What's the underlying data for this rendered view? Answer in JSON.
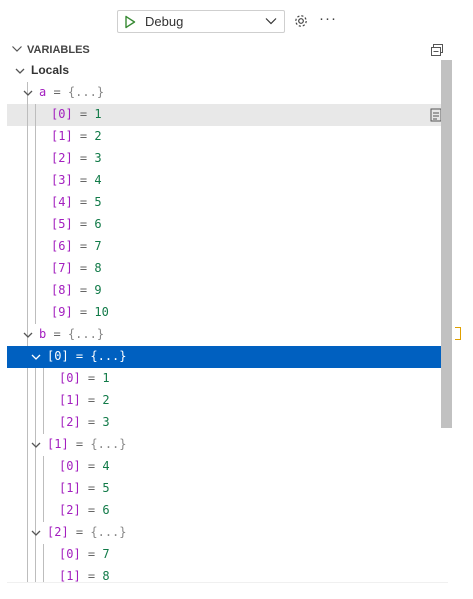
{
  "toolbar": {
    "config_name": "Debug"
  },
  "section": {
    "title": "VARIABLES"
  },
  "rows": [
    {
      "kind": "scope",
      "label": "Locals",
      "depth": 0,
      "open": true
    },
    {
      "kind": "var",
      "key": "a",
      "value": "{...}",
      "depth": 1,
      "expandable": true,
      "open": true
    },
    {
      "kind": "var",
      "key": "[0]",
      "value": "1",
      "depth": 2,
      "state": "hover"
    },
    {
      "kind": "var",
      "key": "[1]",
      "value": "2",
      "depth": 2
    },
    {
      "kind": "var",
      "key": "[2]",
      "value": "3",
      "depth": 2
    },
    {
      "kind": "var",
      "key": "[3]",
      "value": "4",
      "depth": 2
    },
    {
      "kind": "var",
      "key": "[4]",
      "value": "5",
      "depth": 2
    },
    {
      "kind": "var",
      "key": "[5]",
      "value": "6",
      "depth": 2
    },
    {
      "kind": "var",
      "key": "[6]",
      "value": "7",
      "depth": 2
    },
    {
      "kind": "var",
      "key": "[7]",
      "value": "8",
      "depth": 2
    },
    {
      "kind": "var",
      "key": "[8]",
      "value": "9",
      "depth": 2
    },
    {
      "kind": "var",
      "key": "[9]",
      "value": "10",
      "depth": 2
    },
    {
      "kind": "var",
      "key": "b",
      "value": "{...}",
      "depth": 1,
      "expandable": true,
      "open": true
    },
    {
      "kind": "var",
      "key": "[0]",
      "value": "{...}",
      "depth": 2,
      "expandable": true,
      "open": true,
      "state": "selected"
    },
    {
      "kind": "var",
      "key": "[0]",
      "value": "1",
      "depth": 3
    },
    {
      "kind": "var",
      "key": "[1]",
      "value": "2",
      "depth": 3
    },
    {
      "kind": "var",
      "key": "[2]",
      "value": "3",
      "depth": 3
    },
    {
      "kind": "var",
      "key": "[1]",
      "value": "{...}",
      "depth": 2,
      "expandable": true,
      "open": true
    },
    {
      "kind": "var",
      "key": "[0]",
      "value": "4",
      "depth": 3
    },
    {
      "kind": "var",
      "key": "[1]",
      "value": "5",
      "depth": 3
    },
    {
      "kind": "var",
      "key": "[2]",
      "value": "6",
      "depth": 3
    },
    {
      "kind": "var",
      "key": "[2]",
      "value": "{...}",
      "depth": 2,
      "expandable": true,
      "open": true
    },
    {
      "kind": "var",
      "key": "[0]",
      "value": "7",
      "depth": 3
    },
    {
      "kind": "var",
      "key": "[1]",
      "value": "8",
      "depth": 3
    }
  ],
  "colors": {
    "selection": "#0060c0",
    "key": "#a31fbf",
    "number": "#117a48",
    "hover": "#e8e8e8"
  },
  "icons": {
    "run": "play-icon",
    "settings": "gear-icon",
    "more": "more-icon",
    "collapse": "collapse-all-icon",
    "copy": "copy-value-icon"
  }
}
